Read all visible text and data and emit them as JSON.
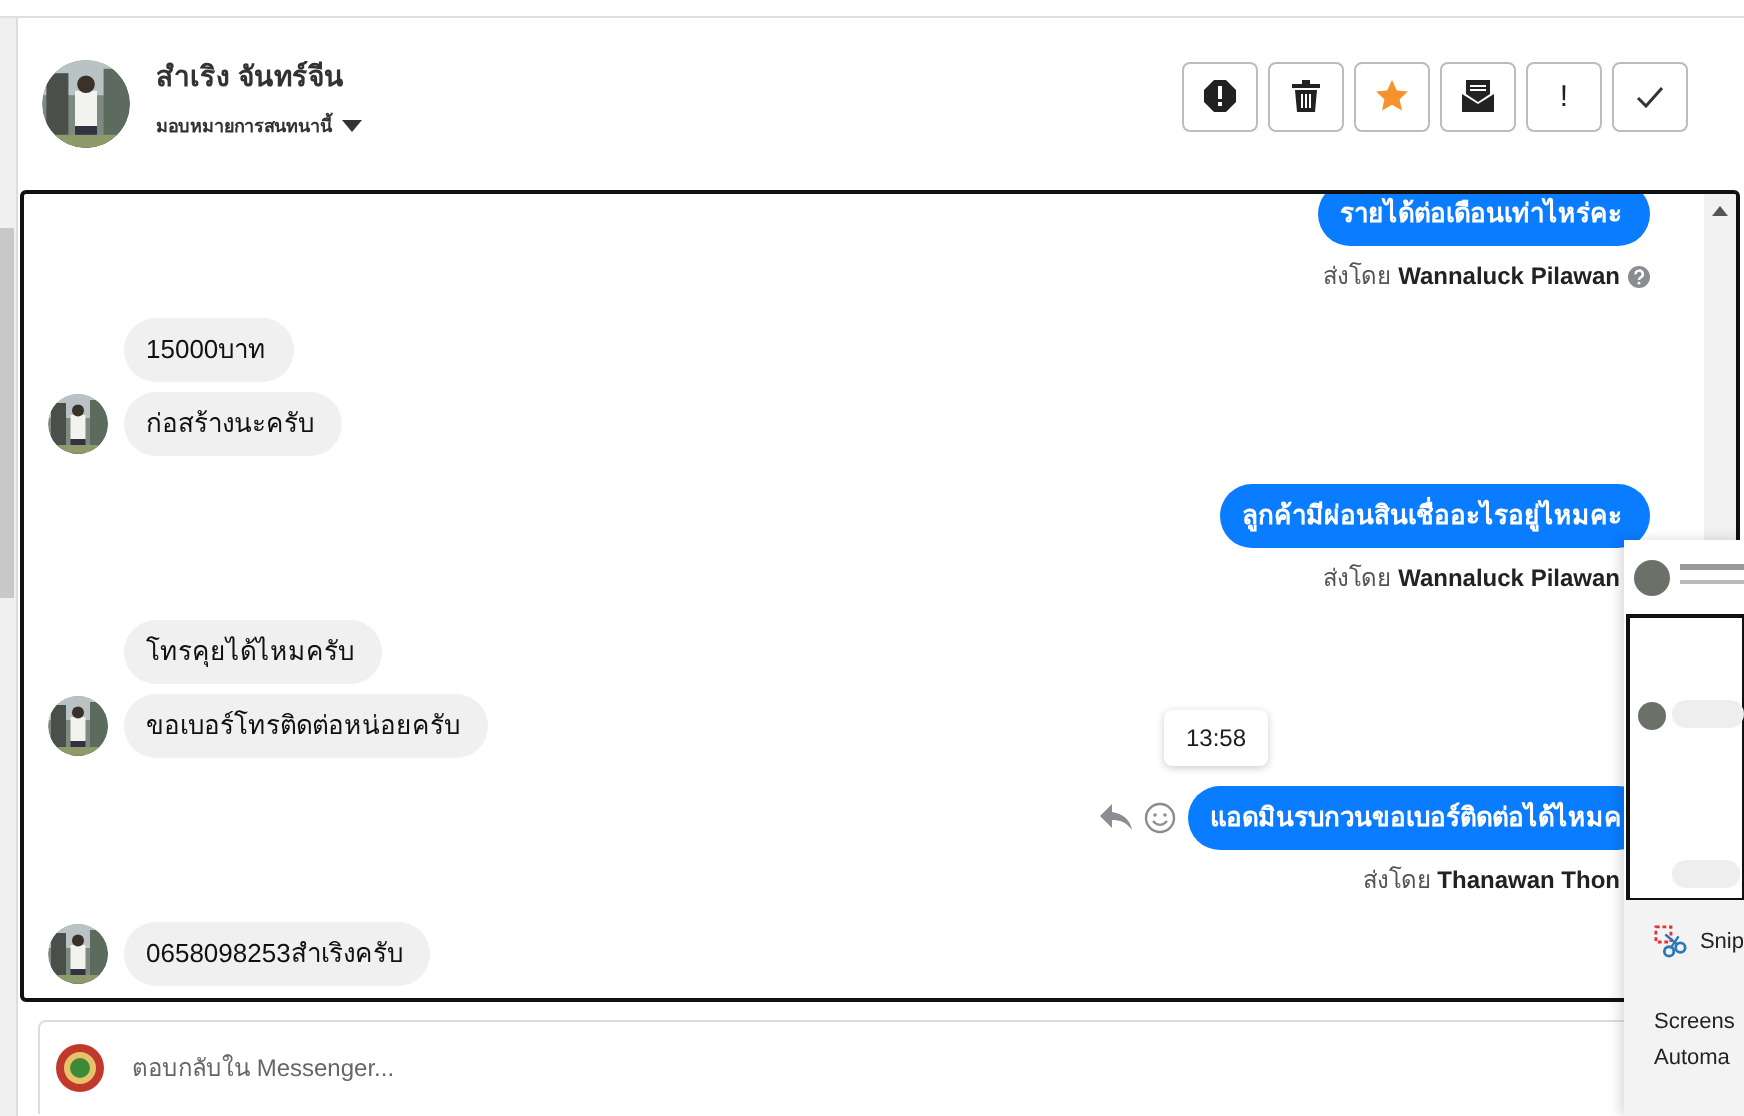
{
  "header": {
    "name": "สำเริง จันทร์จีน",
    "assign_label": "มอบหมายการสนทนานี้"
  },
  "action_buttons": [
    {
      "kind": "block"
    },
    {
      "kind": "delete"
    },
    {
      "kind": "star"
    },
    {
      "kind": "mail"
    },
    {
      "kind": "text",
      "label": "!"
    },
    {
      "kind": "done"
    }
  ],
  "messages": [
    {
      "kind": "outgoing",
      "text": "รายได้ต่อเดือนเท่าไหร่คะ"
    },
    {
      "kind": "sender",
      "prefix": "ส่งโดย",
      "name": "Wannaluck Pilawan",
      "help_icon": true
    },
    {
      "kind": "incoming",
      "text": "15000บาท",
      "avatar": false
    },
    {
      "kind": "incoming",
      "text": "ก่อสร้างนะครับ",
      "avatar": true
    },
    {
      "kind": "outgoing",
      "text": "ลูกค้ามีผ่อนสินเชื่ออะไรอยู่ไหมคะ"
    },
    {
      "kind": "sender",
      "prefix": "ส่งโดย",
      "name": "Wannaluck Pilawan"
    },
    {
      "kind": "incoming",
      "text": "โทรคุยได้ไหมครับ",
      "avatar": false
    },
    {
      "kind": "incoming",
      "text": "ขอเบอร์โทรติดต่อหน่อยครับ",
      "avatar": true
    },
    {
      "kind": "outgoing",
      "text": "แอดมินรบกวนขอเบอร์ติดต่อได้ไหมค",
      "hover_actions": true,
      "tooltip": "13:58"
    },
    {
      "kind": "sender",
      "prefix": "ส่งโดย",
      "name": "Thanawan Thon"
    },
    {
      "kind": "incoming",
      "text": "0658098253สำเริงครับ",
      "avatar": true
    }
  ],
  "composer": {
    "placeholder": "ตอบกลับใน Messenger..."
  },
  "notification": {
    "app": "Snip",
    "lines": [
      "Screens",
      "Automa"
    ]
  }
}
